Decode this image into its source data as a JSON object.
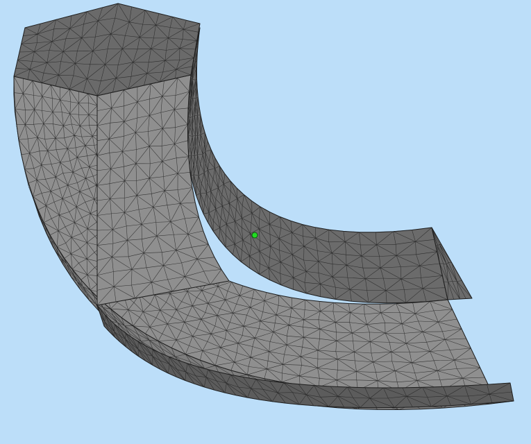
{
  "viewport": {
    "background_color": "#bcdef9",
    "view": "3d-perspective"
  },
  "model": {
    "shape": "curved-block (quarter-ring segment)",
    "rendering": "shaded-with-mesh-edges",
    "mesh_type": "triangular",
    "colors": {
      "top_face": "#6a6a6a",
      "front_face": "#8f8f8f",
      "outer_side_face": "#7e7e7e",
      "inner_side_face": "#6b6b6b",
      "lower_edge_band": "#5c5c5c",
      "mesh_line": "#222222",
      "face_edge": "#1c1c1c"
    }
  },
  "selection_point": {
    "color": "#22dd22",
    "outline": "#0a5a0a",
    "icon": "point-marker-icon"
  }
}
